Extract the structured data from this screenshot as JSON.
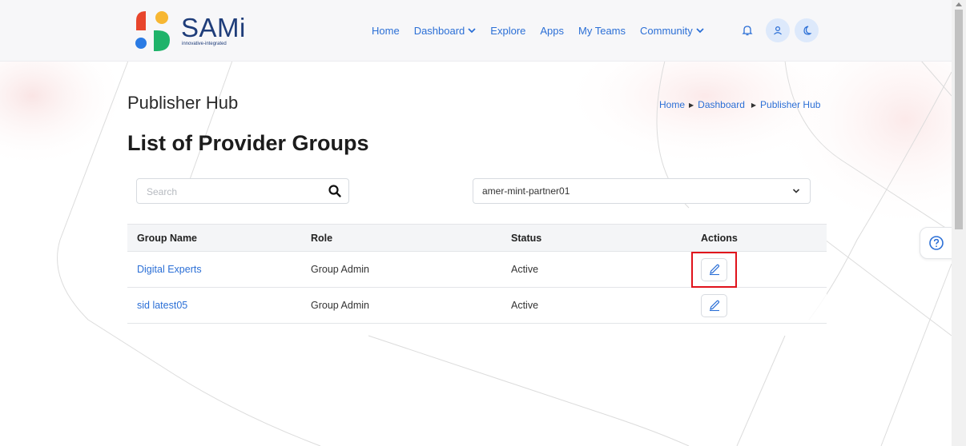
{
  "logo": {
    "brand": "SAMi",
    "tagline": "innovative-integrated"
  },
  "nav": {
    "items": [
      {
        "label": "Home",
        "dropdown": false
      },
      {
        "label": "Dashboard",
        "dropdown": true
      },
      {
        "label": "Explore",
        "dropdown": false
      },
      {
        "label": "Apps",
        "dropdown": false
      },
      {
        "label": "My Teams",
        "dropdown": false
      },
      {
        "label": "Community",
        "dropdown": true
      }
    ],
    "icons": [
      "bell-icon",
      "user-icon",
      "moon-icon"
    ]
  },
  "page": {
    "title": "Publisher Hub",
    "breadcrumb": [
      "Home",
      "Dashboard",
      "Publisher Hub"
    ],
    "section_title": "List of Provider Groups"
  },
  "search": {
    "placeholder": "Search",
    "value": ""
  },
  "partner_select": {
    "selected": "amer-mint-partner01"
  },
  "table": {
    "headers": [
      "Group Name",
      "Role",
      "Status",
      "Actions"
    ],
    "rows": [
      {
        "name": "Digital Experts",
        "role": "Group Admin",
        "status": "Active"
      },
      {
        "name": "sid latest05",
        "role": "Group Admin",
        "status": "Active"
      }
    ]
  },
  "colors": {
    "link": "#2b6fd6",
    "highlight": "#e0121b",
    "brand": "#1f3d7a"
  }
}
